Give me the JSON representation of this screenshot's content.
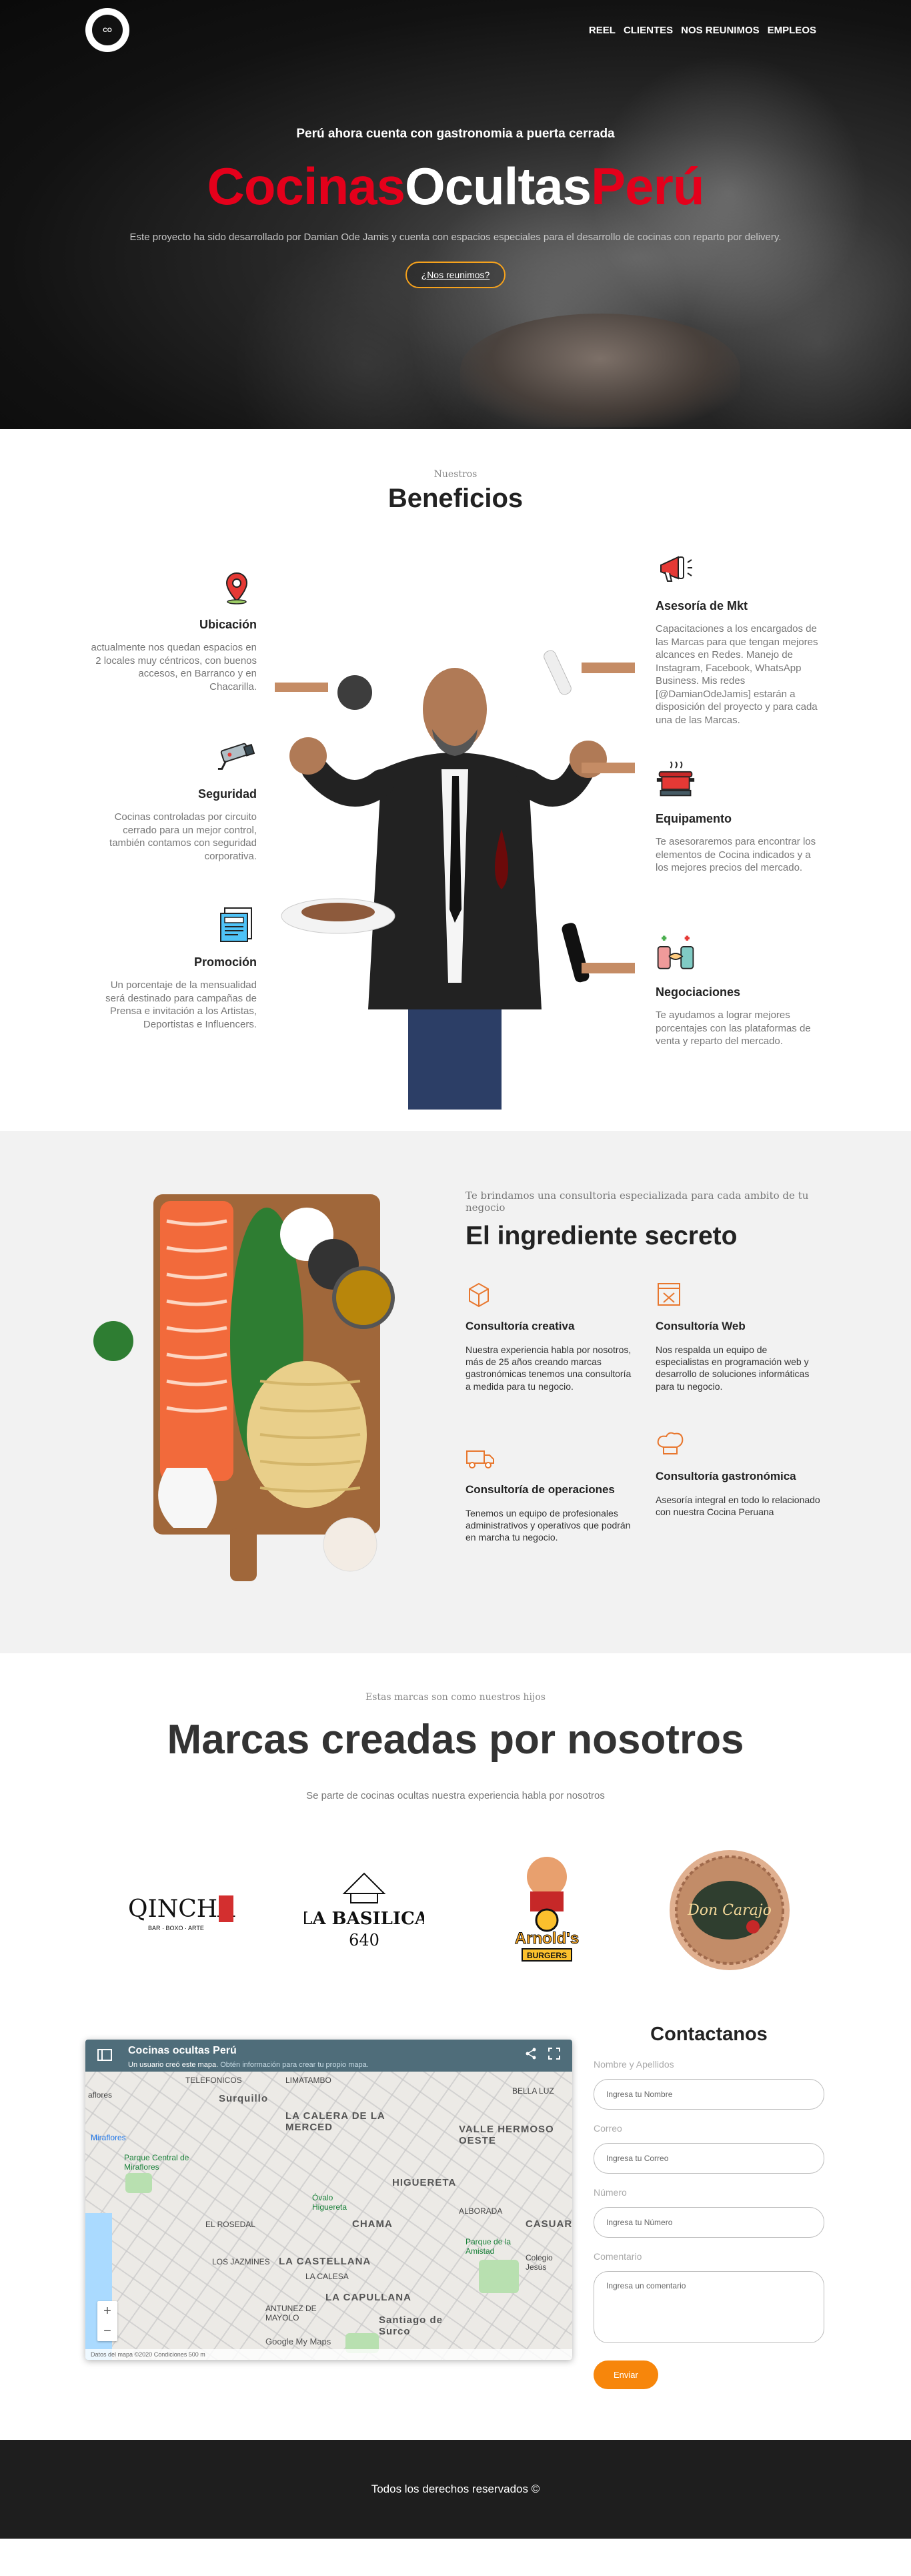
{
  "nav": {
    "logo_text": "CO",
    "items": [
      "REEL",
      "CLIENTES",
      "NOS REUNIMOS",
      "EMPLEOS"
    ]
  },
  "hero": {
    "subtitle": "Perú ahora cuenta con gastronomia a puerta cerrada",
    "title_1": "Cocinas",
    "title_2": "Ocultas",
    "title_3": "Perú",
    "description": "Este proyecto ha sido desarrollado por Damian Ode Jamis y cuenta con espacios especiales para el desarrollo de cocinas con reparto por delivery.",
    "cta": "¿Nos reunimos?"
  },
  "benefits": {
    "kicker": "Nuestros",
    "title": "Beneficios",
    "left": [
      {
        "icon": "map-pin-icon",
        "title": "Ubicación",
        "text": "actualmente nos quedan espacios en 2 locales muy céntricos, con buenos accesos, en Barranco y en Chacarilla."
      },
      {
        "icon": "security-camera-icon",
        "title": "Seguridad",
        "text": "Cocinas controladas por circuito cerrado para un mejor control, también contamos con seguridad corporativa."
      },
      {
        "icon": "newspaper-icon",
        "title": "Promoción",
        "text": "Un porcentaje de la mensualidad será destinado para campañas de Prensa e invitación a los Artistas, Deportistas e Influencers."
      }
    ],
    "right": [
      {
        "icon": "megaphone-icon",
        "title": "Asesoría de Mkt",
        "text": "Capacitaciones a los encargados de las Marcas para que tengan mejores alcances en Redes. Manejo de Instagram, Facebook, WhatsApp Business. Mis redes [@DamianOdeJamis] estarán a disposición del proyecto y para cada una de las Marcas."
      },
      {
        "icon": "cooking-pot-icon",
        "title": "Equipamento",
        "text": "Te asesoraremos para encontrar los elementos de Cocina indicados y a los mejores precios del mercado."
      },
      {
        "icon": "handshake-icon",
        "title": "Negociaciones",
        "text": "Te ayudamos a lograr mejores porcentajes con las plataformas de venta y reparto del mercado."
      }
    ]
  },
  "ingredient": {
    "kicker": "Te brindamos una consultoria especializada para cada ambito de tu negocio",
    "title": "El ingrediente secreto",
    "items": [
      {
        "icon": "box-icon",
        "title": "Consultoría creativa",
        "text": "Nuestra experiencia habla por nosotros, más de 25 años creando marcas gastronómicas tenemos una consultoría a medida para tu negocio."
      },
      {
        "icon": "web-design-icon",
        "title": "Consultoría Web",
        "text": "Nos respalda un equipo de especialistas en programación web y desarrollo de soluciones informáticas para tu negocio."
      },
      {
        "icon": "delivery-truck-icon",
        "title": "Consultoría de operaciones",
        "text": "Tenemos un equipo de profesionales administrativos y operativos que podrán en marcha tu negocio."
      },
      {
        "icon": "chef-hat-icon",
        "title": "Consultoría gastronómica",
        "text": "Asesoría integral en todo lo relacionado con nuestra Cocina Peruana"
      }
    ]
  },
  "brands": {
    "kicker": "Estas marcas son como nuestros hijos",
    "title": "Marcas creadas por nosotros",
    "description": "Se parte de cocinas ocultas nuestra experiencia habla por nosotros",
    "logos": [
      {
        "name": "QINCHA",
        "tagline": "BAR · BOXO · ARTE"
      },
      {
        "name": "LA BASILICA",
        "number": "640"
      },
      {
        "name": "Arnold's",
        "tagline": "BURGERS"
      },
      {
        "name": "Don Carajo",
        "tagline": ""
      }
    ]
  },
  "map": {
    "title": "Cocinas ocultas Perú",
    "notice": "Un usuario creó este mapa.",
    "notice_link": "Obtén información para crear tu propio mapa.",
    "labels": [
      "Surquillo",
      "LA CALERA DE LA MERCED",
      "VALLE HERMOSO OESTE",
      "HIGUERETA",
      "CHAMA",
      "LA CASTELLANA",
      "LA CAPULLANA",
      "Santiago de Surco",
      "Miraflores",
      "Parque Central de Miraflores",
      "EL ROSEDAL",
      "Óvalo Higuereta",
      "Parque de la Amistad",
      "TELEFONICOS",
      "LIMATAMBO",
      "BELLA LUZ",
      "CASUARINAS",
      "ANTUNEZ DE MAYOLO",
      "LOS JAZMINES",
      "ALBORADA",
      "LA CALESA",
      "Colegio Jesús",
      "aflores",
      "Google My Maps"
    ],
    "footer": "Datos del mapa ©2020   Condiciones   500 m"
  },
  "contact": {
    "title": "Contactanos",
    "fields": [
      {
        "label": "Nombre y Apellidos",
        "placeholder": "Ingresa tu Nombre"
      },
      {
        "label": "Correo",
        "placeholder": "Ingresa tu Correo"
      },
      {
        "label": "Número",
        "placeholder": "Ingresa tu Número"
      },
      {
        "label": "Comentario",
        "placeholder": "Ingresa un comentario"
      }
    ],
    "submit": "Enviar"
  },
  "footer": {
    "text": "Todos los derechos reservados ©"
  },
  "colors": {
    "accent_red": "#e4001b",
    "accent_orange": "#f7860b",
    "hero_bg": "#111111",
    "section_gray": "#f2f2f2",
    "footer_bg": "#1e1e1e"
  }
}
